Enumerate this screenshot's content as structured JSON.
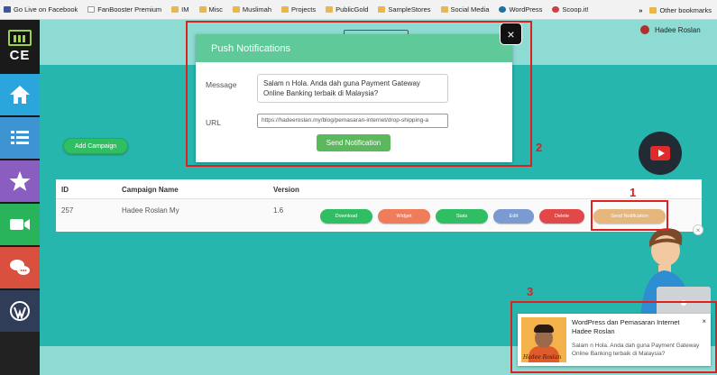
{
  "bookmarks": {
    "items": [
      {
        "label": "Go Live on Facebook",
        "icon": "facebook-icon"
      },
      {
        "label": "FanBooster Premium",
        "icon": "page-icon"
      },
      {
        "label": "IM",
        "icon": "folder-icon"
      },
      {
        "label": "Misc",
        "icon": "folder-icon"
      },
      {
        "label": "Muslimah",
        "icon": "folder-icon"
      },
      {
        "label": "Projects",
        "icon": "folder-icon"
      },
      {
        "label": "PublicGold",
        "icon": "folder-icon"
      },
      {
        "label": "SampleStores",
        "icon": "folder-icon"
      },
      {
        "label": "Social Media",
        "icon": "folder-icon"
      },
      {
        "label": "WordPress",
        "icon": "wordpress-icon"
      },
      {
        "label": "Scoop.it!",
        "icon": "scoopit-icon"
      }
    ],
    "more": "»",
    "other": "Other bookmarks"
  },
  "sidebar": {
    "logo_text": "CE",
    "items": [
      "home-icon",
      "list-icon",
      "star-icon",
      "video-icon",
      "chat-icon",
      "wordpress-icon"
    ]
  },
  "user": {
    "name": "Hadee Roslan"
  },
  "main": {
    "add_campaign": "Add Campaign"
  },
  "table": {
    "headers": {
      "id": "ID",
      "name": "Campaign Name",
      "version": "Version"
    },
    "rows": [
      {
        "id": "257",
        "name": "Hadee Roslan My",
        "version": "1.6"
      }
    ],
    "actions": {
      "download": "Download",
      "widget": "Widget",
      "stats": "Stats",
      "edit": "Edit",
      "delete": "Delete",
      "send": "Send Notification"
    }
  },
  "modal": {
    "title": "Push Notifications",
    "message_label": "Message",
    "message_value": "Salam n Hola. Anda dah guna Payment Gateway Online Banking terbaik di Malaysia?",
    "url_label": "URL",
    "url_value": "https://hadeeroslan.my/blog/pemasaran-internet/drop-shipping-a",
    "send_label": "Send Notification",
    "close": "×"
  },
  "annotations": {
    "n1": "1",
    "n2": "2",
    "n3": "3"
  },
  "toast": {
    "title": "WordPress dan Pemasaran Internet Hadee Roslan",
    "body": "Salam n Hola. Anda dah guna Payment Gateway Online Banking terbaik di Malaysia?",
    "close": "×",
    "image_caption": "Hadee Roslan"
  },
  "colors": {
    "teal": "#26b6ae",
    "light_teal": "#8ddbd3",
    "modal_header": "#5fc99a",
    "highlight": "#e01f1f"
  }
}
